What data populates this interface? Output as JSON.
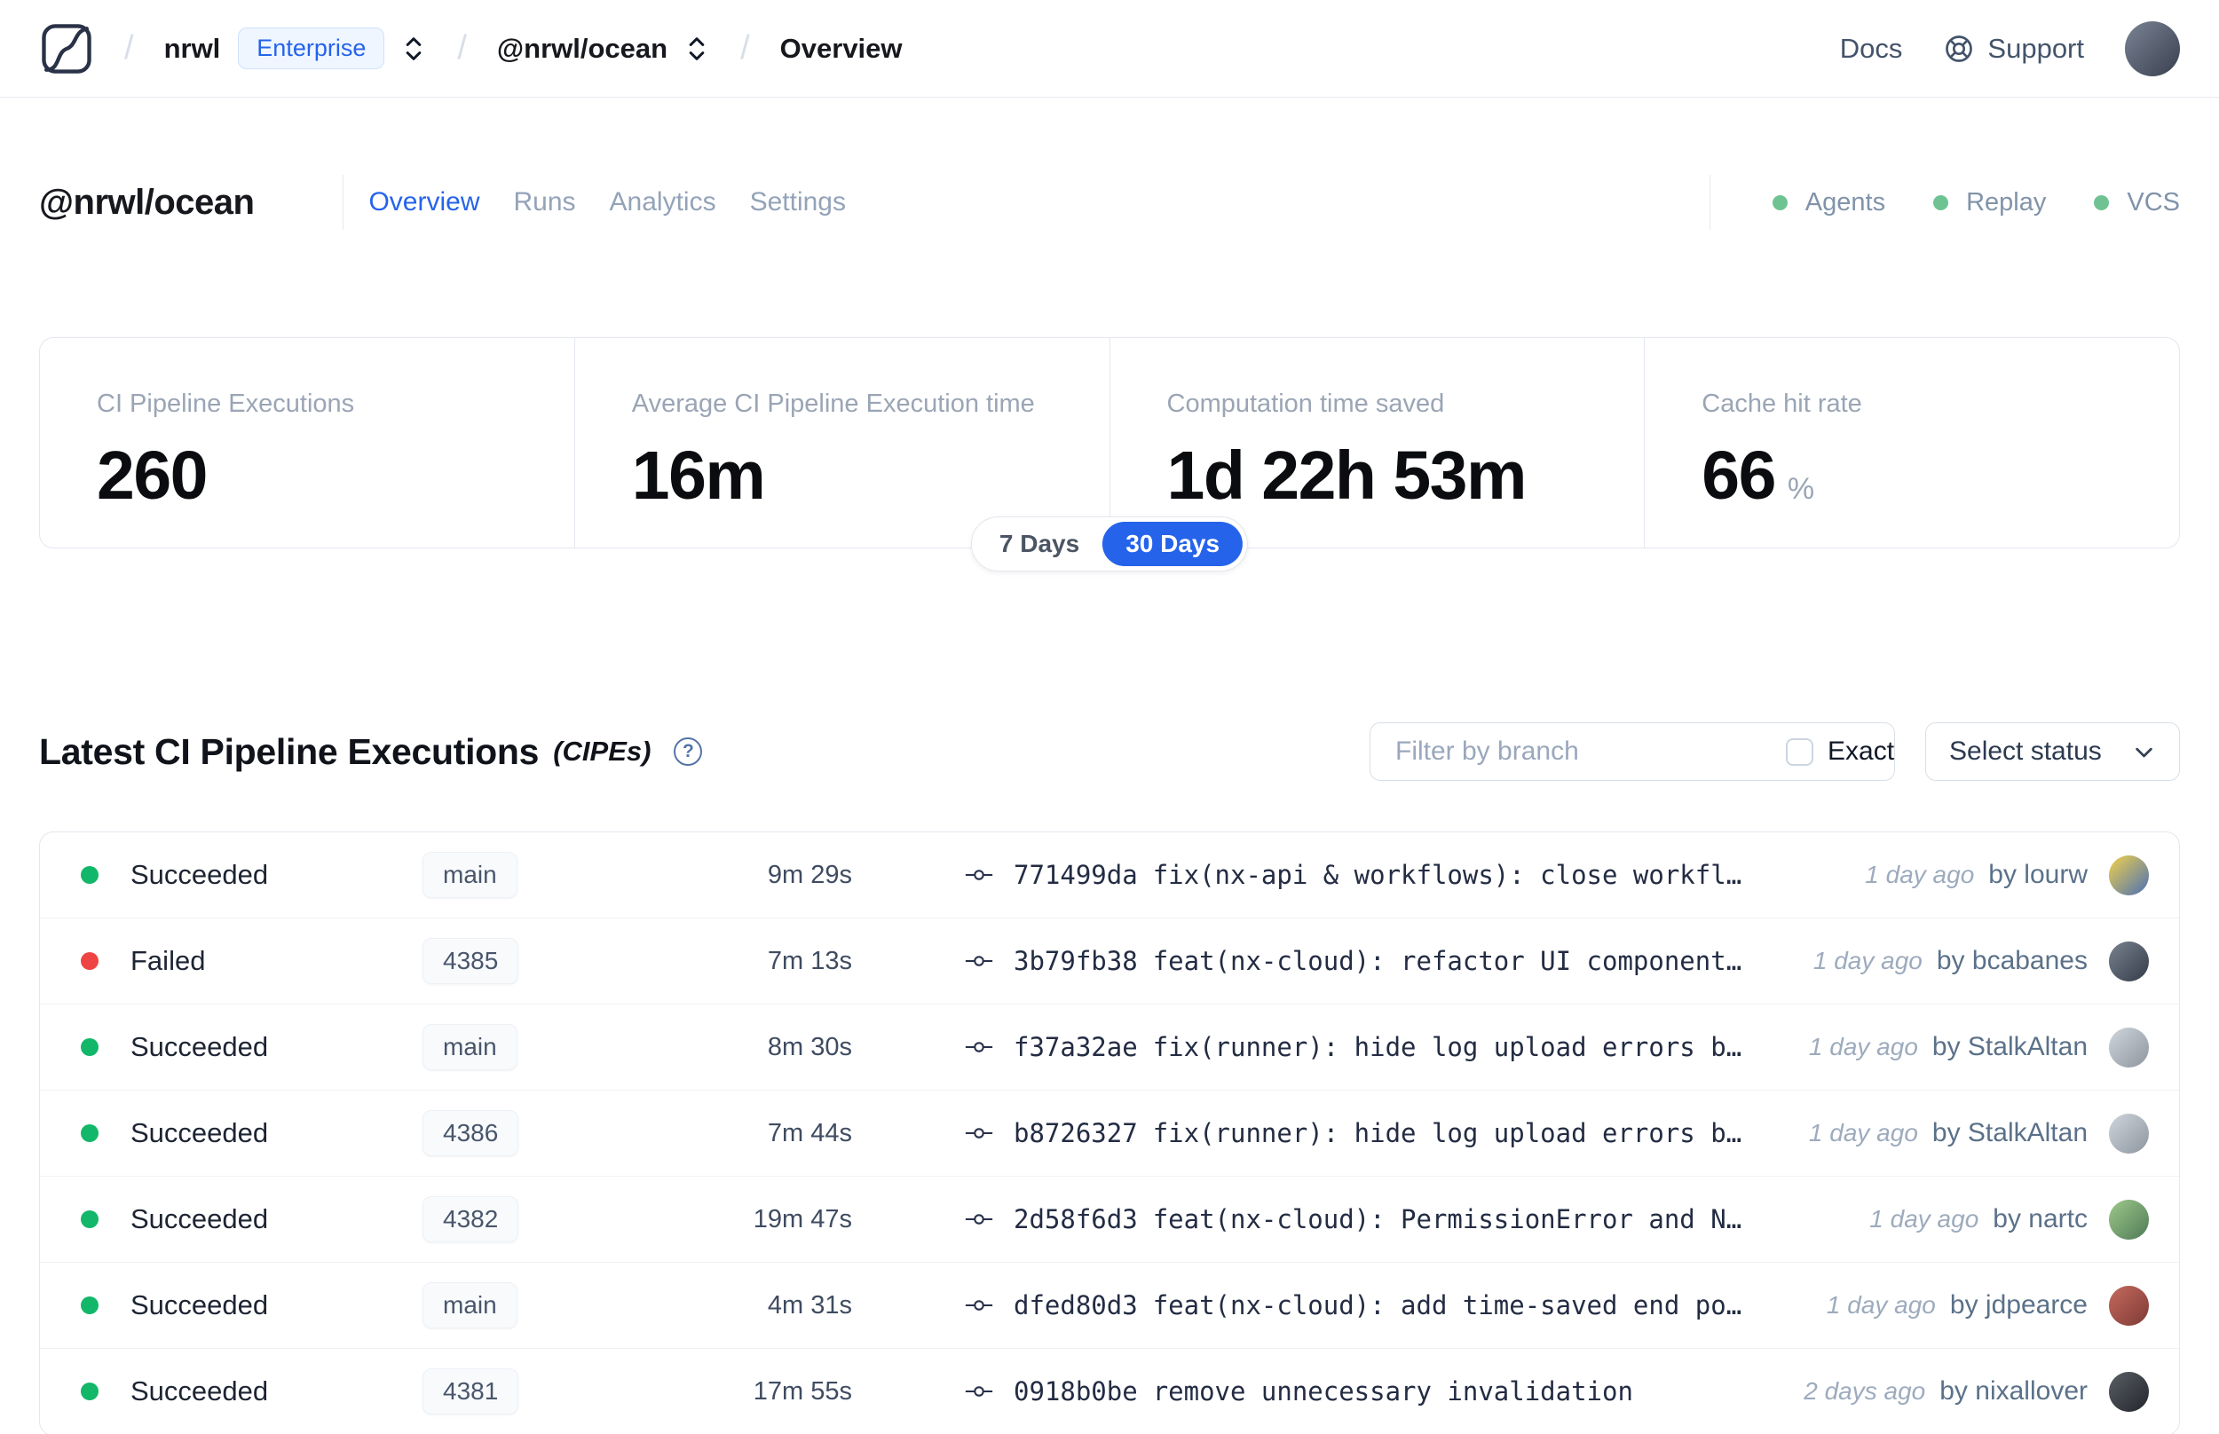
{
  "nav": {
    "breadcrumb": {
      "org": "nrwl",
      "org_badge": "Enterprise",
      "workspace": "@nrwl/ocean",
      "page": "Overview",
      "separator": "/"
    },
    "links": {
      "docs": "Docs",
      "support": "Support"
    }
  },
  "workspace": {
    "title": "@nrwl/ocean",
    "tabs": [
      {
        "label": "Overview",
        "active": true
      },
      {
        "label": "Runs",
        "active": false
      },
      {
        "label": "Analytics",
        "active": false
      },
      {
        "label": "Settings",
        "active": false
      }
    ],
    "indicators": [
      {
        "label": "Agents"
      },
      {
        "label": "Replay"
      },
      {
        "label": "VCS"
      }
    ]
  },
  "stats": {
    "cards": [
      {
        "label": "CI Pipeline Executions",
        "value": "260"
      },
      {
        "label": "Average CI Pipeline Execution time",
        "value": "16m"
      },
      {
        "label": "Computation time saved",
        "value": "1d 22h 53m"
      },
      {
        "label": "Cache hit rate",
        "value": "66",
        "unit": "%"
      }
    ],
    "period_options": [
      "7 Days",
      "30 Days"
    ],
    "selected_period": "30 Days"
  },
  "cipe_section": {
    "title": "Latest CI Pipeline Executions",
    "title_suffix": "(CIPEs)",
    "help_glyph": "?",
    "filter_placeholder": "Filter by branch",
    "exact_label": "Exact",
    "status_select_label": "Select status",
    "rows": [
      {
        "status": "Succeeded",
        "status_kind": "success",
        "branch": "main",
        "duration": "9m 29s",
        "commit_hash": "771499da",
        "commit_message": "fix(nx-api & workflows): close workfl…",
        "time_ago": "1 day ago",
        "author": "by lourw",
        "avatar_colors": [
          "#f2d24b",
          "#4a6fb5"
        ]
      },
      {
        "status": "Failed",
        "status_kind": "failed",
        "branch": "4385",
        "duration": "7m 13s",
        "commit_hash": "3b79fb38",
        "commit_message": "feat(nx-cloud): refactor UI component…",
        "time_ago": "1 day ago",
        "author": "by bcabanes",
        "avatar_colors": [
          "#79828f",
          "#343c49"
        ]
      },
      {
        "status": "Succeeded",
        "status_kind": "success",
        "branch": "main",
        "duration": "8m 30s",
        "commit_hash": "f37a32ae",
        "commit_message": "fix(runner): hide log upload errors b…",
        "time_ago": "1 day ago",
        "author": "by StalkAltan",
        "avatar_colors": [
          "#cfd6dd",
          "#8d959e"
        ]
      },
      {
        "status": "Succeeded",
        "status_kind": "success",
        "branch": "4386",
        "duration": "7m 44s",
        "commit_hash": "b8726327",
        "commit_message": "fix(runner): hide log upload errors b…",
        "time_ago": "1 day ago",
        "author": "by StalkAltan",
        "avatar_colors": [
          "#cfd6dd",
          "#8d959e"
        ]
      },
      {
        "status": "Succeeded",
        "status_kind": "success",
        "branch": "4382",
        "duration": "19m 47s",
        "commit_hash": "2d58f6d3",
        "commit_message": "feat(nx-cloud): PermissionError and N…",
        "time_ago": "1 day ago",
        "author": "by nartc",
        "avatar_colors": [
          "#9ec98a",
          "#4f7a57"
        ]
      },
      {
        "status": "Succeeded",
        "status_kind": "success",
        "branch": "main",
        "duration": "4m 31s",
        "commit_hash": "dfed80d3",
        "commit_message": "feat(nx-cloud): add time-saved end po…",
        "time_ago": "1 day ago",
        "author": "by jdpearce",
        "avatar_colors": [
          "#c56a5d",
          "#7e3a36"
        ]
      },
      {
        "status": "Succeeded",
        "status_kind": "success",
        "branch": "4381",
        "duration": "17m 55s",
        "commit_hash": "0918b0be",
        "commit_message": "remove unnecessary invalidation",
        "time_ago": "2 days ago",
        "author": "by nixallover",
        "avatar_colors": [
          "#5a5e66",
          "#23262b"
        ]
      }
    ]
  },
  "colors": {
    "accent": "#2563eb",
    "status": {
      "success": "#12b76a",
      "failed": "#ef4444"
    },
    "indicator_dot": "#6fc392",
    "nav_avatar": [
      "#7b8494",
      "#394050"
    ]
  }
}
